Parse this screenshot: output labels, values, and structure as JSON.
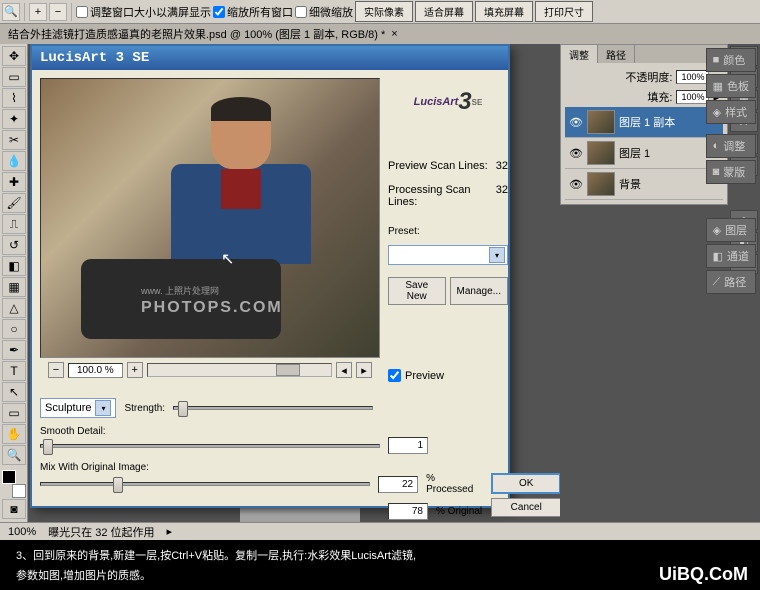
{
  "toolbar": {
    "check1": "调整窗口大小以满屏显示",
    "check2": "缩放所有窗口",
    "check3": "细微缩放",
    "btn_actual": "实际像素",
    "btn_fit": "适合屏幕",
    "btn_fill": "填充屏幕",
    "btn_print": "打印尺寸"
  },
  "doc_tab": "结合外挂滤镜打造质感逼真的老照片效果.psd @ 100% (图层 1 副本, RGB/8) *",
  "dialog": {
    "title": "LucisArt 3 SE",
    "logo_main": "LucisArt",
    "logo_num": "3",
    "logo_se": "SE",
    "preview_scan_label": "Preview Scan Lines:",
    "preview_scan_val": "32",
    "processing_scan_label": "Processing Scan Lines:",
    "processing_scan_val": "32",
    "preset_label": "Preset:",
    "save_new": "Save New",
    "manage": "Manage...",
    "preview_check": "Preview",
    "zoom": "100.0 %",
    "mode_label": "Sculpture",
    "strength_label": "Strength:",
    "smooth_label": "Smooth Detail:",
    "smooth_val": "1",
    "mix_label": "Mix With Original Image:",
    "mix_processed": "22",
    "mix_original": "78",
    "pct_processed": "% Processed",
    "pct_original": "% Original",
    "ok": "OK",
    "cancel": "Cancel",
    "watermark": "PHOTOPS.COM",
    "watermark_sm": "www. 上照片处理网"
  },
  "panels": {
    "tab_adjust": "调整",
    "tab_mask": "蒙版",
    "tab_path": "路径",
    "opacity_label": "不透明度:",
    "opacity_val": "100%",
    "fill_label": "填充:",
    "fill_val": "100%",
    "layer1_copy": "图层 1 副本",
    "layer1": "图层 1",
    "bg_layer": "背景"
  },
  "side": {
    "color": "颜色",
    "swatch": "色板",
    "style": "样式",
    "adjust": "调整",
    "mask": "蒙版",
    "layer": "图层",
    "channel": "通道",
    "path": "路径"
  },
  "status": {
    "zoom": "100%",
    "info": "曝光只在 32 位起作用"
  },
  "caption": {
    "line1": "3、回到原来的背景,新建一层,按Ctrl+V粘贴。复制一层,执行:水彩效果LucisArt滤镜,",
    "line2": "参数如图,增加图片的质感。",
    "logo": "UiBQ.CoM"
  }
}
